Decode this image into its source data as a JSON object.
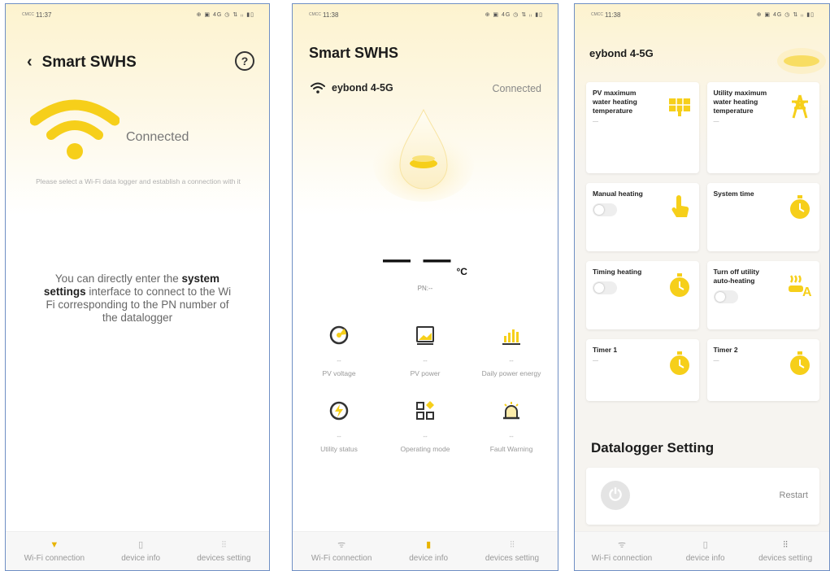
{
  "colors": {
    "accent": "#f6cf1a",
    "frame": "#6f8fc4"
  },
  "screens": [
    {
      "status": {
        "carrier": "CMCC",
        "time": "11:37",
        "icons": "⊕ ▣ 4G ◷ ⇅ ᵢᵢ ▮▯"
      },
      "header": {
        "title": "Smart SWHS"
      },
      "connected": "Connected",
      "hint": "Please select a Wi-Fi data logger and establish a connection with it",
      "info": {
        "part1": "You can directly enter the ",
        "bold": "system settings",
        "part2": " interface to connect to the Wi Fi corresponding to the PN number of the datalogger"
      },
      "nav": [
        "Wi-Fi connection",
        "device info",
        "devices setting"
      ]
    },
    {
      "status": {
        "carrier": "CMCC",
        "time": "11:38",
        "icons": "⊕ ▣ 4G ◷ ⇅ ᵢᵢ ▮▯"
      },
      "header": {
        "title": "Smart SWHS"
      },
      "network": "eybond 4-5G",
      "connected": "Connected",
      "temperature": "— —",
      "unit": "°C",
      "pn": "PN:--",
      "metrics": [
        {
          "value": "--",
          "label": "PV voltage",
          "icon": "gauge-icon"
        },
        {
          "value": "--",
          "label": "PV power",
          "icon": "monitor-icon"
        },
        {
          "value": "--",
          "label": "Daily power energy",
          "icon": "bar-chart-icon"
        },
        {
          "value": "--",
          "label": "Utility status",
          "icon": "lightning-icon"
        },
        {
          "value": "--",
          "label": "Operating mode",
          "icon": "apps-icon"
        },
        {
          "value": "--",
          "label": "Fault Warning",
          "icon": "alarm-icon"
        }
      ],
      "nav": [
        "Wi-Fi connection",
        "device info",
        "devices setting"
      ]
    },
    {
      "status": {
        "carrier": "CMCC",
        "time": "11:38",
        "icons": "⊕ ▣ 4G ◷ ⇅ ᵢᵢ ▮▯"
      },
      "network": "eybond 4-5G",
      "cards": {
        "pv_max": {
          "label": "PV maximum water heating temperature",
          "value": "—"
        },
        "utility_max": {
          "label": "Utility maximum water heating temperature",
          "value": "—"
        },
        "manual": {
          "label": "Manual heating"
        },
        "system_time": {
          "label": "System time"
        },
        "timing": {
          "label": "Timing heating"
        },
        "turn_off": {
          "label": "Turn off utility auto-heating"
        },
        "timer1": {
          "label": "Timer 1",
          "value": "—"
        },
        "timer2": {
          "label": "Timer 2",
          "value": "—"
        }
      },
      "datalogger_title": "Datalogger Setting",
      "restart": "Restart",
      "nav": [
        "Wi-Fi connection",
        "device info",
        "devices setting"
      ]
    }
  ]
}
